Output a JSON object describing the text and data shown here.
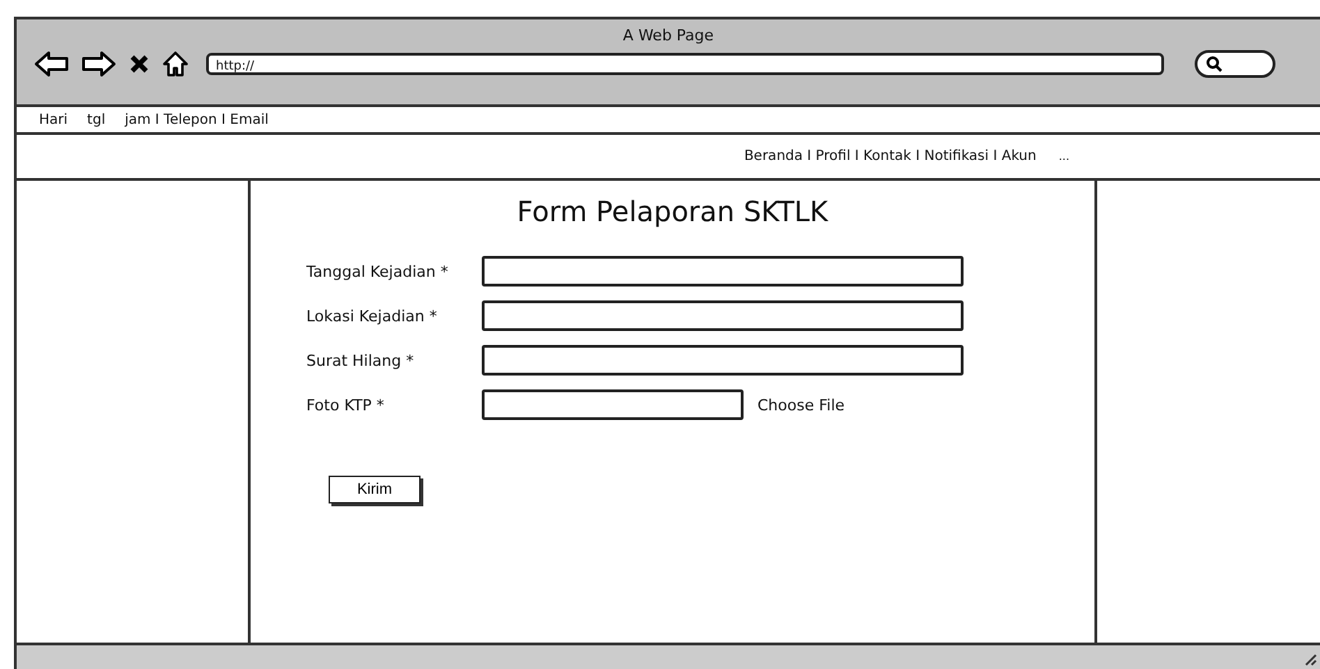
{
  "window": {
    "title": "A Web Page"
  },
  "address_bar": {
    "value": "http://"
  },
  "info_bar": [
    "Hari",
    "tgl",
    "jam I Telepon I Email"
  ],
  "nav": {
    "links": "Beranda I Profil I Kontak I Notifikasi I  Akun",
    "more": "..."
  },
  "form": {
    "title": "Form Pelaporan SKTLK",
    "fields": [
      {
        "kind": "text",
        "label": "Tanggal Kejadian *"
      },
      {
        "kind": "text",
        "label": "Lokasi Kejadian *"
      },
      {
        "kind": "text",
        "label": "Surat Hilang *"
      },
      {
        "kind": "file",
        "label": "Foto KTP *",
        "button": "Choose File"
      }
    ],
    "submit": "Kirim"
  }
}
